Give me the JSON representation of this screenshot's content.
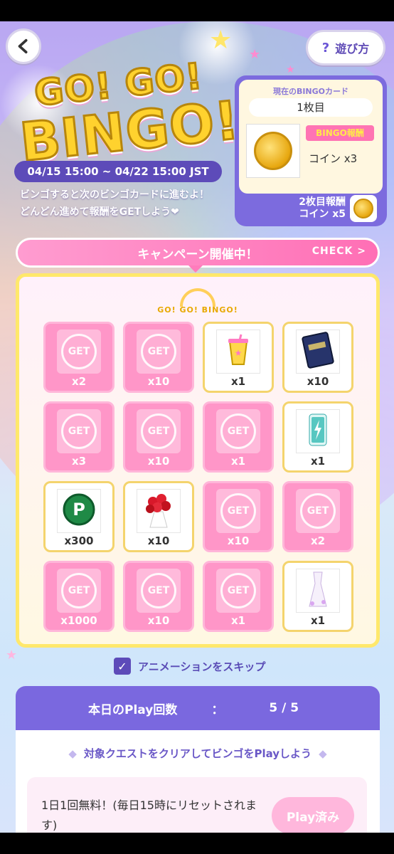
{
  "header": {
    "help_label": "遊び方",
    "logo_line1": "GO! GO!",
    "logo_line2": "BINGO!",
    "period": "04/15 15:00 ~ 04/22 15:00 JST",
    "desc_line1": "ビンゴすると次のビンゴカードに進むよ！",
    "desc_line2": "どんどん進めて報酬をGETしよう❤"
  },
  "card": {
    "title": "現在のBINGOカード",
    "count": "1枚目",
    "bingo_tag": "BINGO報酬",
    "bingo_reward": "コイン x3",
    "next_line1": "2枚目報酬",
    "next_line2": "コイン x5"
  },
  "campaign": {
    "label": "キャンペーン開催中！",
    "check": "CHECK >"
  },
  "board": {
    "logo": "GO! GO! BINGO!",
    "get_label": "GET",
    "cells": [
      {
        "qty": "x2",
        "state": "got",
        "icon": "get-icon"
      },
      {
        "qty": "x10",
        "state": "got",
        "icon": "get-icon"
      },
      {
        "qty": "x1",
        "state": "open",
        "icon": "drink-cup-icon"
      },
      {
        "qty": "x10",
        "state": "open",
        "icon": "book-icon"
      },
      {
        "qty": "x3",
        "state": "got",
        "icon": "get-icon"
      },
      {
        "qty": "x10",
        "state": "got",
        "icon": "get-icon"
      },
      {
        "qty": "x1",
        "state": "got",
        "icon": "get-icon"
      },
      {
        "qty": "x1",
        "state": "open",
        "icon": "battery-icon"
      },
      {
        "qty": "x300",
        "state": "open",
        "icon": "p-coin-icon"
      },
      {
        "qty": "x10",
        "state": "open",
        "icon": "rose-bouquet-icon"
      },
      {
        "qty": "x10",
        "state": "got",
        "icon": "get-icon"
      },
      {
        "qty": "x2",
        "state": "got",
        "icon": "get-icon"
      },
      {
        "qty": "x1000",
        "state": "got",
        "icon": "get-icon"
      },
      {
        "qty": "x10",
        "state": "got",
        "icon": "get-icon"
      },
      {
        "qty": "x1",
        "state": "got",
        "icon": "get-icon"
      },
      {
        "qty": "x1",
        "state": "open",
        "icon": "dress-icon"
      }
    ]
  },
  "skip": {
    "label": "アニメーションをスキップ",
    "checked": true
  },
  "play": {
    "today_label": "本日のPlay回数",
    "colon": "：",
    "count": "5 / 5",
    "hint": "対象クエストをクリアしてビンゴをPlayしよう",
    "free_text": "1日1回無料！(毎日15時にリセットされます)",
    "button_label": "Play済み"
  },
  "colors": {
    "accent": "#7a68df",
    "pink": "#ff96c8",
    "gold": "#ffd22e"
  }
}
